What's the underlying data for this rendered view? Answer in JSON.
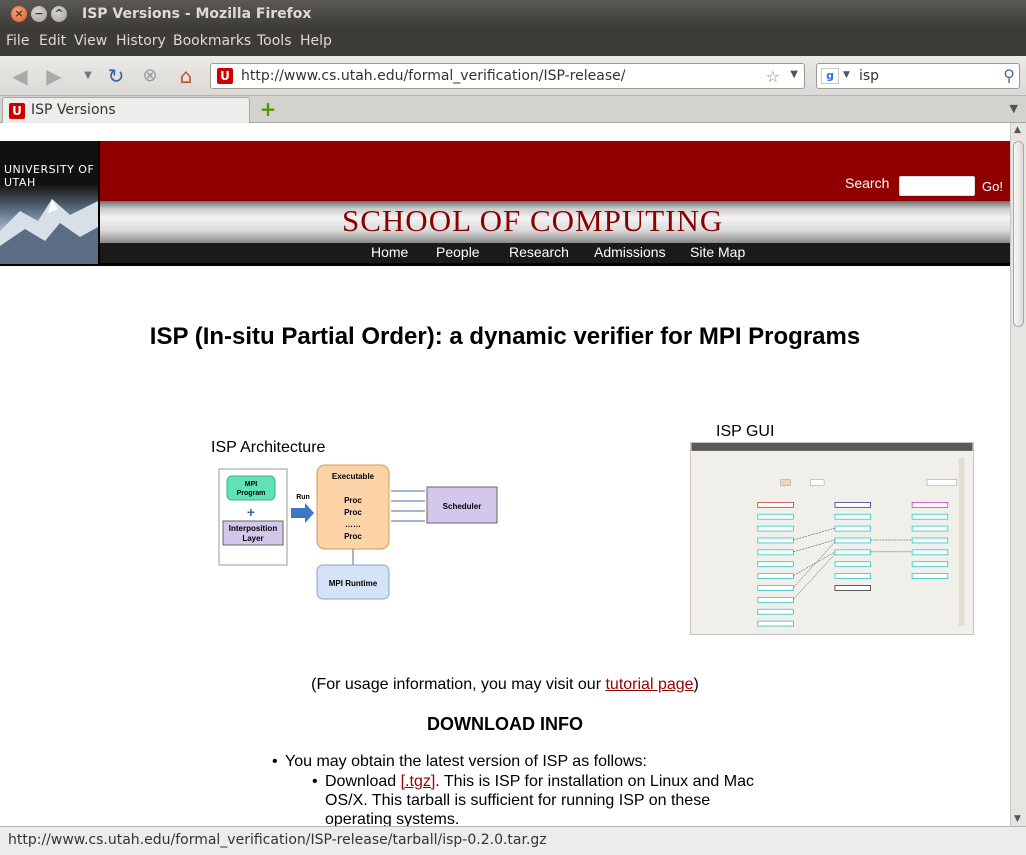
{
  "window": {
    "title": "ISP Versions - Mozilla Firefox"
  },
  "menu": {
    "file": "File",
    "edit": "Edit",
    "view": "View",
    "history": "History",
    "bookmarks": "Bookmarks",
    "tools": "Tools",
    "help": "Help"
  },
  "nav": {
    "url": "http://www.cs.utah.edu/formal_verification/ISP-release/",
    "search_value": "isp",
    "search_engine_icon": "google-icon"
  },
  "tabs": [
    {
      "label": "ISP Versions"
    }
  ],
  "page": {
    "banner": {
      "logo_text": "UNIVERSITY OF UTAH",
      "school_name": "SCHOOL OF COMPUTING",
      "search_label": "Search",
      "go_label": "Go!",
      "nav_items": [
        "Home",
        "People",
        "Research",
        "Admissions",
        "Site Map"
      ],
      "colors": {
        "red": "#900000",
        "title_red": "#8a0000"
      }
    },
    "title": "ISP (In-situ Partial Order): a dynamic verifier for MPI Programs",
    "architecture": {
      "label": "ISP Architecture",
      "mpi_program": "MPI Program",
      "interposition": "Interposition Layer",
      "run": "Run",
      "executable": "Executable",
      "proc1": "Proc",
      "proc2": "Proc",
      "dots": "……",
      "procn": "Proc",
      "scheduler": "Scheduler",
      "runtime": "MPI Runtime"
    },
    "gui_label": "ISP GUI",
    "usage_prefix": "(For usage information, you may visit our ",
    "usage_link": "tutorial page",
    "usage_suffix": ")",
    "download_heading": "DOWNLOAD INFO",
    "bullet1": "You may obtain the latest version of ISP as follows:",
    "bullet2_prefix": "Download ",
    "bullet2_link": "[.tgz]",
    "bullet2_suffix": ". This is ISP for installation on Linux and Mac OS/X. This tarball is sufficient for running ISP on these operating systems."
  },
  "status": {
    "text": "http://www.cs.utah.edu/formal_verification/ISP-release/tarball/isp-0.2.0.tar.gz"
  }
}
